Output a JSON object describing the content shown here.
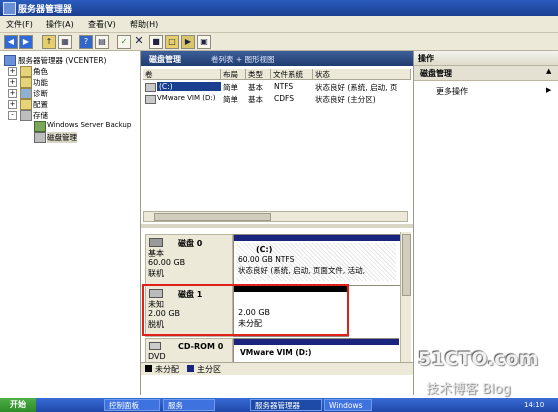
{
  "window": {
    "title": "服务器管理器"
  },
  "menu": [
    "文件(F)",
    "操作(A)",
    "查看(V)",
    "帮助(H)"
  ],
  "toolbar_icons": [
    "back-icon",
    "forward-icon",
    "up-icon",
    "console-tree-icon",
    "help-icon",
    "properties-icon",
    "refresh-icon",
    "delete-icon",
    "export-icon",
    "open-icon",
    "rescan-icon",
    "disk-icon"
  ],
  "tree": {
    "root": "服务器管理器 (VCENTER)",
    "items": [
      {
        "label": "角色",
        "expander": "+"
      },
      {
        "label": "功能",
        "expander": "+"
      },
      {
        "label": "诊断",
        "expander": "+"
      },
      {
        "label": "配置",
        "expander": "+"
      },
      {
        "label": "存储",
        "expander": "-"
      }
    ],
    "storage_children": [
      "Windows Server Backup",
      "磁盘管理"
    ]
  },
  "center": {
    "title": "磁盘管理",
    "view_label": "卷列表 + 图形视图",
    "columns": [
      "卷",
      "布局",
      "类型",
      "文件系统",
      "状态"
    ],
    "volumes": [
      {
        "name": "(C:)",
        "layout": "简单",
        "type": "基本",
        "fs": "NTFS",
        "status": "状态良好 (系统, 启动, 页"
      },
      {
        "name": "VMware VIM (D:)",
        "layout": "简单",
        "type": "基本",
        "fs": "CDFS",
        "status": "状态良好 (主分区)"
      }
    ]
  },
  "disks": [
    {
      "name": "磁盘 0",
      "type": "基本",
      "size": "60.00 GB",
      "state": "联机",
      "partition": {
        "label": "(C:)",
        "detail": "60.00 GB NTFS",
        "status": "状态良好 (系统, 启动, 页面文件, 活动,"
      }
    },
    {
      "name": "磁盘 1",
      "type": "未知",
      "size": "2.00 GB",
      "state": "脱机",
      "partition": {
        "label": "",
        "detail": "2.00 GB",
        "status": "未分配"
      }
    },
    {
      "name": "CD-ROM 0",
      "type": "DVD",
      "size": "",
      "state": "",
      "partition": {
        "label": "VMware VIM (D:)",
        "detail": "",
        "status": ""
      }
    }
  ],
  "legend": [
    "未分配",
    "主分区"
  ],
  "actions": {
    "header": "操作",
    "section": "磁盘管理",
    "more": "更多操作"
  },
  "taskbar": {
    "start": "开始",
    "items": [
      "控制面板",
      "服务",
      "服务器管理器",
      "Windows"
    ],
    "clock": "14:10"
  },
  "watermark": {
    "line1": "51CTO.com",
    "line2": "技术博客  Blog"
  },
  "colors": {
    "primary_partition": "#1a237e",
    "unallocated": "#000000",
    "highlight_box": "#e0201a",
    "titlebar": "#1b3f8f"
  }
}
